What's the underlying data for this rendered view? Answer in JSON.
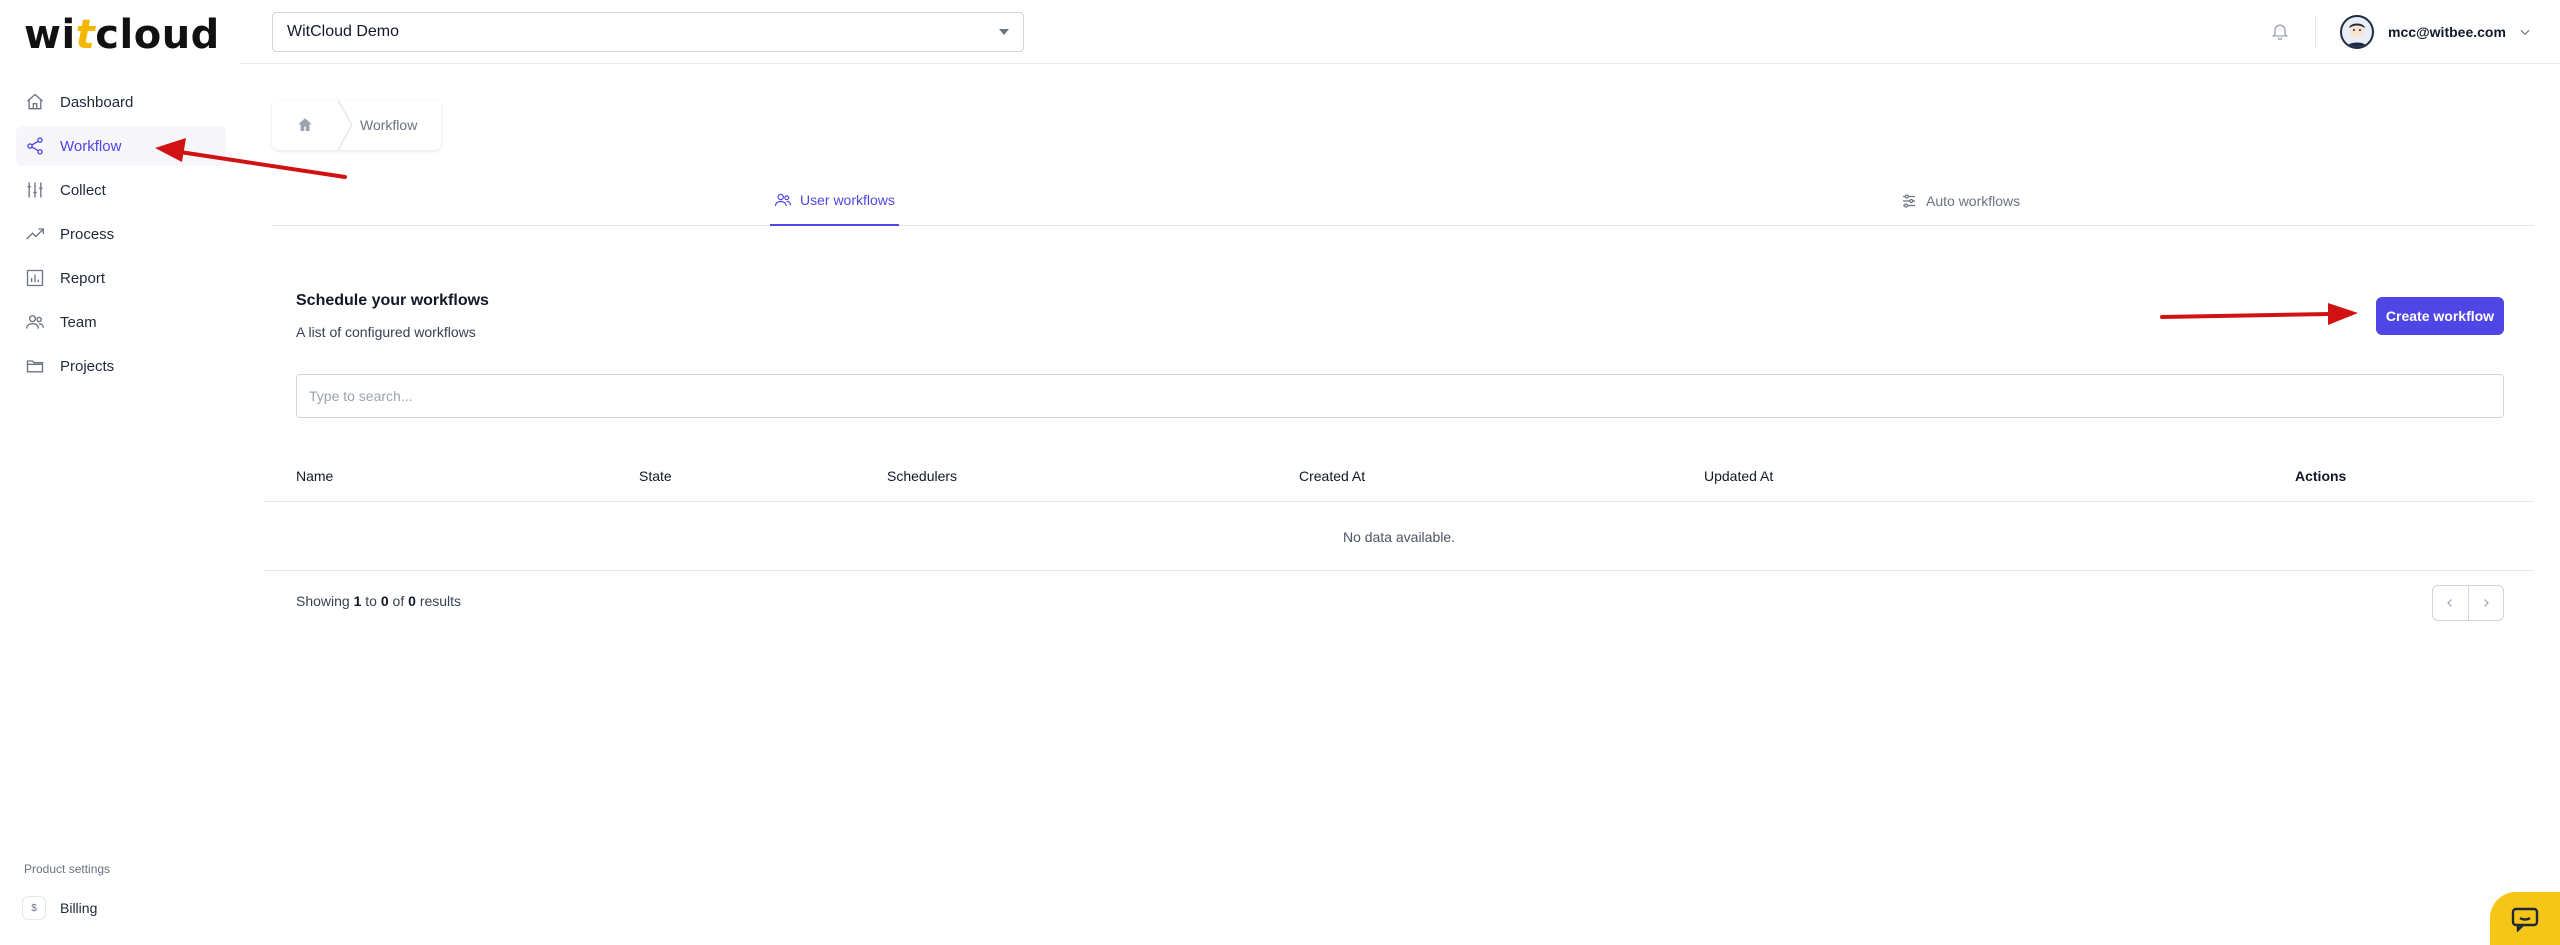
{
  "logo": {
    "part1": "wi",
    "accent": "t",
    "part2": "cloud"
  },
  "sidebar": {
    "items": [
      {
        "label": "Dashboard",
        "icon": "home-icon"
      },
      {
        "label": "Workflow",
        "icon": "share-icon",
        "active": true
      },
      {
        "label": "Collect",
        "icon": "sliders-icon"
      },
      {
        "label": "Process",
        "icon": "trending-icon"
      },
      {
        "label": "Report",
        "icon": "chart-icon"
      },
      {
        "label": "Team",
        "icon": "users-icon"
      },
      {
        "label": "Projects",
        "icon": "folder-icon"
      }
    ],
    "product_settings": "Product settings",
    "billing": {
      "label": "Billing",
      "icon_text": "$"
    }
  },
  "header": {
    "project": "WitCloud Demo",
    "user_email": "mcc@witbee.com"
  },
  "breadcrumb": {
    "current": "Workflow"
  },
  "tabs": [
    {
      "label": "User workflows",
      "icon": "users-icon",
      "active": true
    },
    {
      "label": "Auto workflows",
      "icon": "adjustments-icon",
      "active": false
    }
  ],
  "section": {
    "title": "Schedule your workflows",
    "subtitle": "A list of configured workflows",
    "create_label": "Create workflow",
    "search_placeholder": "Type to search..."
  },
  "table": {
    "columns": [
      "Name",
      "State",
      "Schedulers",
      "Created At",
      "Updated At",
      "Actions"
    ],
    "empty": "No data available."
  },
  "pagination": {
    "prefix": "Showing",
    "from": "1",
    "to_word": "to",
    "to": "0",
    "of_word": "of",
    "total": "0",
    "suffix": "results"
  },
  "colors": {
    "accent": "#4f46e5",
    "annotation": "#d11212",
    "chat": "#f5c518"
  }
}
